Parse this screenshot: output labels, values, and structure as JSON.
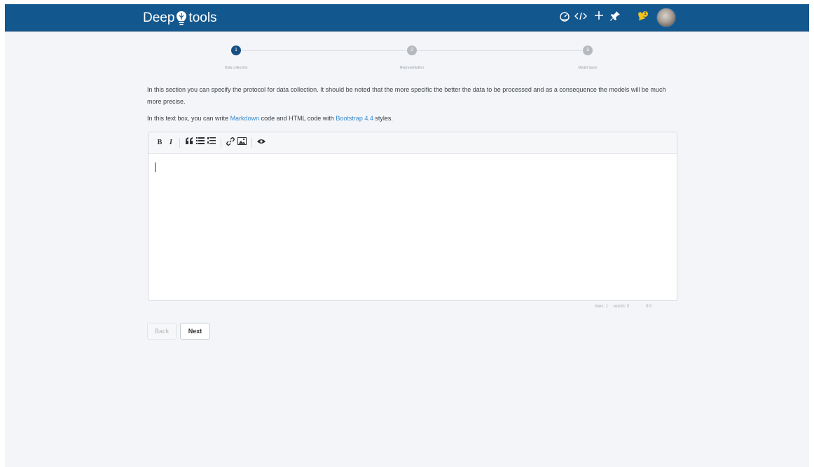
{
  "app": {
    "logo_left": "Deep",
    "logo_right": "tools"
  },
  "nav": {
    "icons": [
      "dashboard-icon",
      "code-icon",
      "plus-icon",
      "pin-icon",
      "bell-icon",
      "avatar"
    ],
    "notification_badge": "1"
  },
  "stepper": {
    "steps": [
      {
        "number": "1",
        "label": "Data collection",
        "active": true
      },
      {
        "number": "2",
        "label": "Representation",
        "active": false
      },
      {
        "number": "3",
        "label": "Model types",
        "active": false
      }
    ]
  },
  "content": {
    "intro": "In this section you can specify the protocol for data collection. It should be noted that the more specific the better the data to be processed and as a consequence the models will be much more precise.",
    "hint_prefix": "In this text box, you can write ",
    "hint_link1": "Markdown",
    "hint_mid": " code and HTML code with ",
    "hint_link2": "Bootstrap 4.4",
    "hint_suffix": " styles."
  },
  "editor": {
    "toolbar": {
      "bold": "B",
      "italic": "I",
      "quote": "❝",
      "unordered_list": "☰",
      "ordered_list": "☷",
      "link": "🔗",
      "image": "🖼",
      "preview": "👁"
    },
    "value": "",
    "status": {
      "lines": "lines: 1",
      "words": "words: 0",
      "cursor": "0:0"
    }
  },
  "buttons": {
    "back": "Back",
    "next": "Next"
  },
  "colors": {
    "topbar": "#13578f",
    "active_step": "#174f82",
    "link": "#3a8ad0"
  }
}
